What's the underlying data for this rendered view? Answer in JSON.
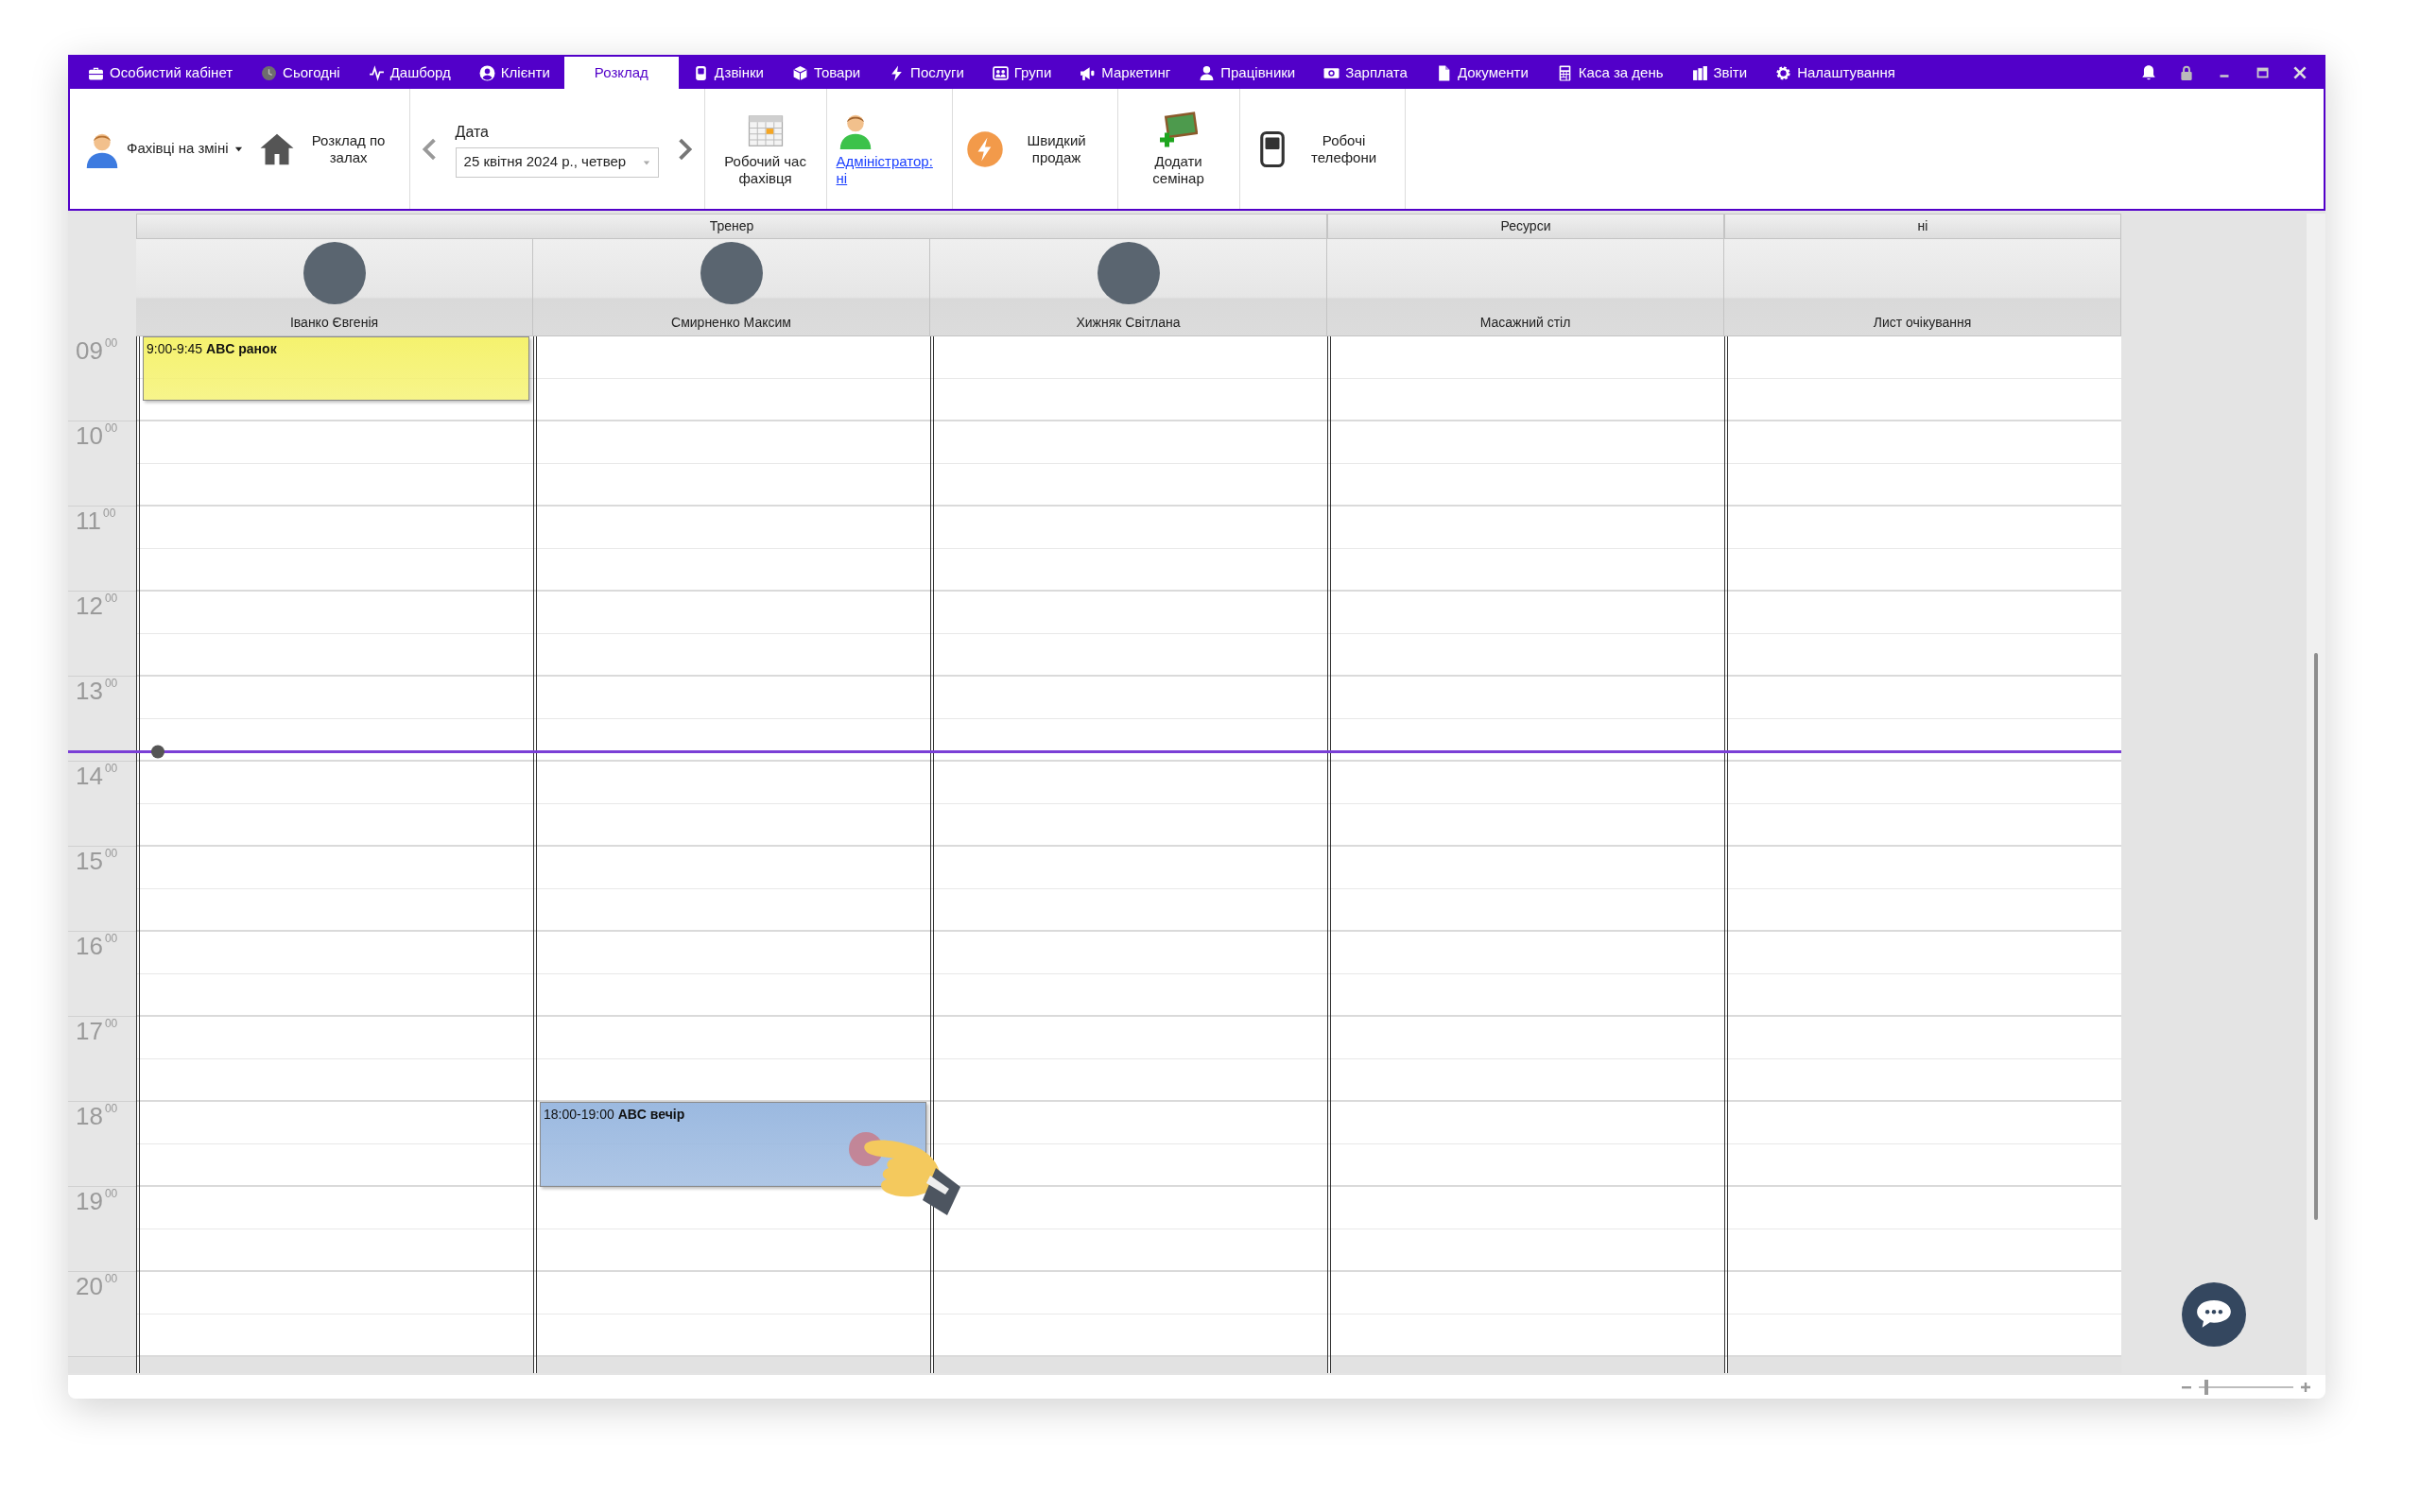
{
  "menu": [
    {
      "label": "Особистий кабінет",
      "selected": false
    },
    {
      "label": "Сьогодні",
      "selected": false
    },
    {
      "label": "Дашборд",
      "selected": false
    },
    {
      "label": "Клієнти",
      "selected": false
    },
    {
      "label": "Розклад",
      "selected": true
    },
    {
      "label": "Дзвінки",
      "selected": false
    },
    {
      "label": "Товари",
      "selected": false
    },
    {
      "label": "Послуги",
      "selected": false
    },
    {
      "label": "Групи",
      "selected": false
    },
    {
      "label": "Маркетинг",
      "selected": false
    },
    {
      "label": "Працівники",
      "selected": false
    },
    {
      "label": "Зарплата",
      "selected": false
    },
    {
      "label": "Документи",
      "selected": false
    },
    {
      "label": "Каса за день",
      "selected": false
    },
    {
      "label": "Звіти",
      "selected": false
    },
    {
      "label": "Налаштування",
      "selected": false
    }
  ],
  "toolbar": [
    {
      "kind": "dropdown",
      "label": "Фахівці на зміні"
    },
    {
      "kind": "button",
      "label": "Розклад по залах"
    },
    {
      "kind": "date",
      "label": "Дата",
      "value": "25 квітня 2024 р., четвер"
    },
    {
      "kind": "button",
      "label": "Робочий час фахівця"
    },
    {
      "kind": "link",
      "label": "Адміністратор: ні"
    },
    {
      "kind": "button",
      "label": "Швидкий продаж"
    },
    {
      "kind": "button",
      "label": "Додати семінар"
    },
    {
      "kind": "button",
      "label": "Робочі телефони"
    }
  ],
  "groups": [
    {
      "label": "Тренер",
      "columns": [
        {
          "kind": "person",
          "name": "Іванко Євгенія",
          "events": [
            {
              "label": "9:00-9:45 **ABC ранок**",
              "color": "#f5f26e"
            }
          ]
        },
        {
          "kind": "person",
          "name": "Смирненко Максим",
          "events": [
            {
              "label": "18:00-19:00 **ABC вечір**",
              "color": "#9bb9e0"
            }
          ]
        },
        {
          "kind": "person",
          "name": "Хижняк Світлана"
        }
      ]
    },
    {
      "label": "Ресурси",
      "columns": [
        {
          "kind": "resource",
          "name": "Масажний стіл"
        }
      ]
    },
    {
      "label": "ні",
      "columns": [
        {
          "kind": "resource",
          "name": "Лист очікування"
        }
      ]
    }
  ],
  "hours": [
    {
      "hour": "09",
      "minutes": "00",
      "current_time": false
    },
    {
      "hour": "10",
      "minutes": "00",
      "current_time": false
    },
    {
      "hour": "11",
      "minutes": "00",
      "current_time": false
    },
    {
      "hour": "12",
      "minutes": "00",
      "current_time": false
    },
    {
      "hour": "13",
      "minutes": "00",
      "current_time": true
    },
    {
      "hour": "14",
      "minutes": "00",
      "current_time": false
    },
    {
      "hour": "15",
      "minutes": "00",
      "current_time": false
    },
    {
      "hour": "16",
      "minutes": "00",
      "current_time": false
    },
    {
      "hour": "17",
      "minutes": "00",
      "current_time": false
    },
    {
      "hour": "18",
      "minutes": "00",
      "current_time": false
    },
    {
      "hour": "19",
      "minutes": "00",
      "current_time": false
    },
    {
      "hour": "20",
      "minutes": "00",
      "current_time": false
    }
  ],
  "zoom_slider": {
    "level": 0.06
  }
}
